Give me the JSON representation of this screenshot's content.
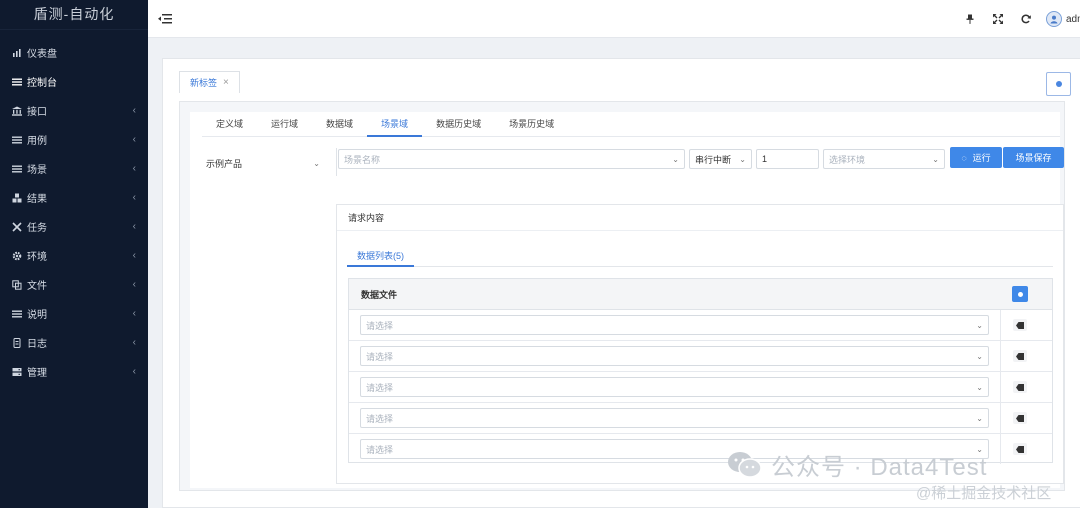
{
  "sidebar": {
    "brand": "盾测-自动化",
    "items": [
      {
        "label": "仪表盘",
        "icon": "chart-icon",
        "arrow": ""
      },
      {
        "label": "控制台",
        "icon": "list-icon",
        "arrow": ""
      },
      {
        "label": "接口",
        "icon": "bank-icon",
        "arrow": "‹"
      },
      {
        "label": "用例",
        "icon": "list-icon",
        "arrow": "‹"
      },
      {
        "label": "场景",
        "icon": "list-icon",
        "arrow": "‹"
      },
      {
        "label": "结果",
        "icon": "cubes-icon",
        "arrow": "‹"
      },
      {
        "label": "任务",
        "icon": "arrows-icon",
        "arrow": "‹"
      },
      {
        "label": "环境",
        "icon": "gear-icon",
        "arrow": "‹"
      },
      {
        "label": "文件",
        "icon": "copy-icon",
        "arrow": "‹"
      },
      {
        "label": "说明",
        "icon": "list-icon",
        "arrow": "‹"
      },
      {
        "label": "日志",
        "icon": "log-icon",
        "arrow": "‹"
      },
      {
        "label": "管理",
        "icon": "server-icon",
        "arrow": "‹"
      }
    ]
  },
  "header": {
    "user": "admin",
    "icons": [
      "pin-icon",
      "fullscreen-icon",
      "refresh-icon"
    ]
  },
  "doc_tab": {
    "label": "新标签",
    "close": "×"
  },
  "sub_tabs": [
    "定义域",
    "运行域",
    "数据域",
    "场景域",
    "数据历史域",
    "场景历史域"
  ],
  "active_sub_tab": 3,
  "controls": {
    "product": "示例产品",
    "scene_placeholder": "场景名称",
    "serial_mode": "串行中断",
    "count": "1",
    "env_placeholder": "选择环境",
    "run_label": "运行",
    "save_label": "场景保存"
  },
  "request": {
    "title": "请求内容",
    "tab_label": "数据列表(5)",
    "table_header": "数据文件",
    "rows": [
      {
        "placeholder": "请选择"
      },
      {
        "placeholder": "请选择"
      },
      {
        "placeholder": "请选择"
      },
      {
        "placeholder": "请选择"
      },
      {
        "placeholder": "请选择"
      }
    ]
  },
  "watermark": {
    "line1": "公众号 · Data4Test",
    "line2": "@稀土掘金技术社区"
  },
  "colors": {
    "accent": "#3f88e8",
    "sidebar": "#0f1a2e"
  }
}
